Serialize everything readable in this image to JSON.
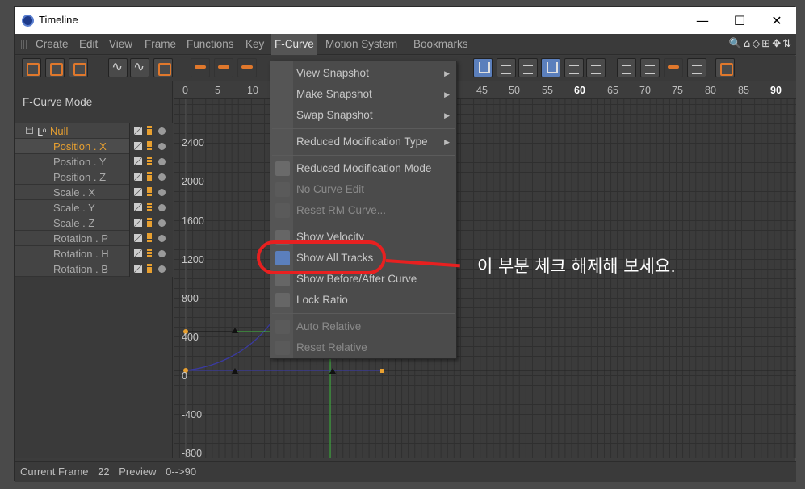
{
  "window": {
    "title": "Timeline",
    "minimize": "—",
    "maximize": "☐",
    "close": "✕"
  },
  "menubar": {
    "items": [
      "Create",
      "Edit",
      "View",
      "Frame",
      "Functions",
      "Key",
      "F-Curve",
      "Motion System",
      "Bookmarks"
    ],
    "active": "F-Curve",
    "right_icons": "🔍⌂◇⊞✥⇅"
  },
  "panel": {
    "mode_label": "F-Curve Mode",
    "null_label": "Null",
    "tracks": [
      "Position . X",
      "Position . Y",
      "Position . Z",
      "Scale . X",
      "Scale . Y",
      "Scale . Z",
      "Rotation . P",
      "Rotation . H",
      "Rotation . B"
    ],
    "selected_track": "Position . X"
  },
  "ruler": {
    "ticks": [
      "0",
      "5",
      "10",
      "45",
      "50",
      "55",
      "60",
      "65",
      "70",
      "75",
      "80",
      "85",
      "90"
    ],
    "bold": [
      "60",
      "90"
    ]
  },
  "yaxis": {
    "labels": [
      "2400",
      "2000",
      "1600",
      "1200",
      "800",
      "400",
      "0",
      "-400",
      "-800"
    ]
  },
  "dropdown": {
    "items": [
      {
        "label": "View Snapshot",
        "submenu": true,
        "disabled": false
      },
      {
        "label": "Make Snapshot",
        "submenu": true,
        "disabled": false
      },
      {
        "label": "Swap Snapshot",
        "submenu": true,
        "disabled": false
      },
      {
        "label": "Reduced Modification Type",
        "submenu": true,
        "disabled": false
      },
      {
        "label": "Reduced Modification Mode",
        "submenu": false,
        "disabled": false
      },
      {
        "label": "No Curve Edit",
        "submenu": false,
        "disabled": true
      },
      {
        "label": "Reset RM Curve...",
        "submenu": false,
        "disabled": true
      },
      {
        "label": "Show Velocity",
        "submenu": false,
        "disabled": false
      },
      {
        "label": "Show All Tracks",
        "submenu": false,
        "disabled": false
      },
      {
        "label": "Show Before/After Curve",
        "submenu": false,
        "disabled": false
      },
      {
        "label": "Lock Ratio",
        "submenu": false,
        "disabled": false
      },
      {
        "label": "Auto Relative",
        "submenu": false,
        "disabled": true
      },
      {
        "label": "Reset Relative",
        "submenu": false,
        "disabled": true
      }
    ]
  },
  "annotation": {
    "text": "이 부분 체크 해제해 보세요.",
    "color": "#e82020"
  },
  "status": {
    "current_frame_label": "Current Frame",
    "current_frame": "22",
    "preview_label": "Preview",
    "preview_range": "0-->90"
  },
  "colors": {
    "accent_orange": "#e8a030",
    "selected_blue": "#5b7fbc",
    "curve_green": "#3fbf3f",
    "curve_blue": "#3a3aa0"
  }
}
